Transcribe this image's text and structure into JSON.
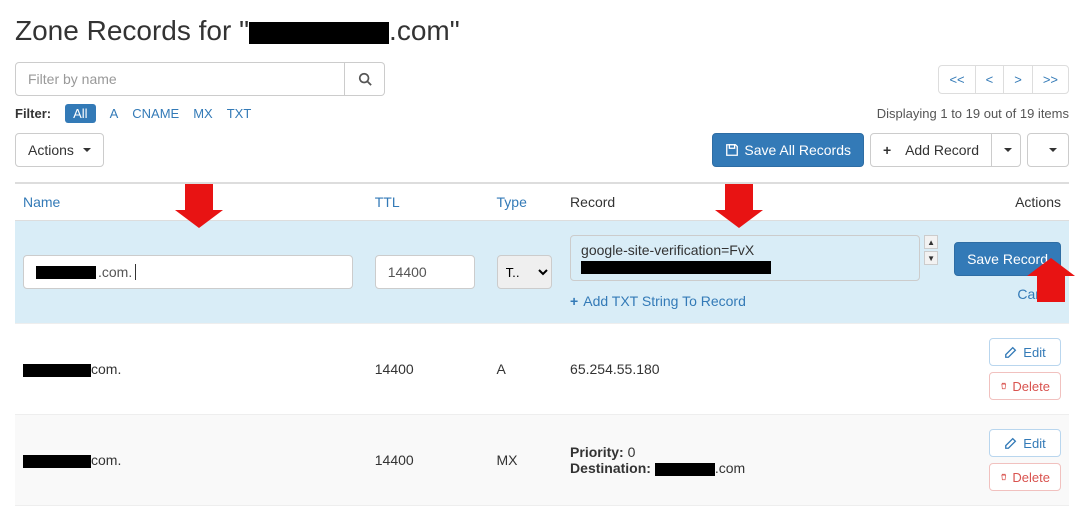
{
  "page": {
    "title_prefix": "Zone Records for \"",
    "title_suffix": ".com\""
  },
  "search": {
    "placeholder": "Filter by name"
  },
  "filter_label": "Filter:",
  "filters": [
    "All",
    "A",
    "CNAME",
    "MX",
    "TXT"
  ],
  "active_filter": "All",
  "display_text": "Displaying 1 to 19 out of 19 items",
  "pagination": {
    "first": "<<",
    "prev": "<",
    "next": ">",
    "last": ">>"
  },
  "toolbar": {
    "actions_label": "Actions",
    "save_all_label": "Save All Records",
    "add_record_label": "Add Record"
  },
  "columns": {
    "name": "Name",
    "ttl": "TTL",
    "type": "Type",
    "record": "Record",
    "actions": "Actions"
  },
  "edit_row": {
    "name_suffix": ".com.",
    "ttl": "14400",
    "type": "T..",
    "record_prefix": "google-site-verification=FvX",
    "add_txt_label": "Add TXT String To Record",
    "save_label": "Save Record",
    "cancel_label": "Cancel"
  },
  "rows": [
    {
      "name_suffix": "com.",
      "ttl": "14400",
      "type": "A",
      "record_text": "65.254.55.180"
    },
    {
      "name_suffix": "com.",
      "ttl": "14400",
      "type": "MX",
      "priority_label": "Priority:",
      "priority_value": "0",
      "destination_label": "Destination:",
      "destination_suffix": ".com"
    }
  ],
  "row_buttons": {
    "edit": "Edit",
    "delete": "Delete"
  }
}
